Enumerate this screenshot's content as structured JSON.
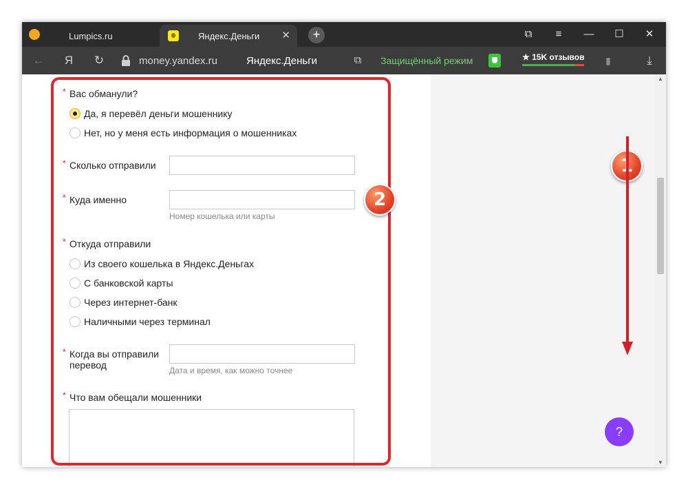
{
  "tabs": [
    {
      "label": "Lumpics.ru"
    },
    {
      "label": "Яндекс.Деньги",
      "close": "✕"
    }
  ],
  "window_controls": {
    "new_tab": "+",
    "collections": "⧉",
    "menu": "≡",
    "minimize": "—",
    "maximize": "☐",
    "close": "✕"
  },
  "addressbar": {
    "back": "←",
    "yandex": "Я",
    "reload": "↻",
    "url": "money.yandex.ru",
    "title": "Яндекс.Деньги",
    "copy_icon": "⧉",
    "secure_mode": "Защищённый режим",
    "reviews": "★ 15K отзывов",
    "bookmark": "▮",
    "download": "⤓"
  },
  "form": {
    "q1": {
      "label": "Вас обманули?",
      "options": [
        "Да, я перевёл деньги мошеннику",
        "Нет, но у меня есть информация о мошенниках"
      ],
      "selected": 0
    },
    "amount": {
      "label": "Сколько отправили",
      "value": ""
    },
    "where": {
      "label": "Куда именно",
      "value": "",
      "hint": "Номер кошелька или карты"
    },
    "from": {
      "label": "Откуда отправили",
      "options": [
        "Из своего кошелька в Яндекс.Деньгах",
        "С банковской карты",
        "Через интернет-банк",
        "Наличными через терминал"
      ]
    },
    "when": {
      "label": "Когда вы отправили перевод",
      "value": "",
      "hint": "Дата и время, как можно точнее"
    },
    "promise": {
      "label": "Что вам обещали мошенники",
      "value": ""
    },
    "required_mark": "*"
  },
  "annotations": {
    "badge1": "1",
    "badge2": "2"
  },
  "help_button": "?",
  "colors": {
    "highlight": "#e0262b",
    "help": "#8b3dff",
    "secure": "#6fd46f"
  }
}
